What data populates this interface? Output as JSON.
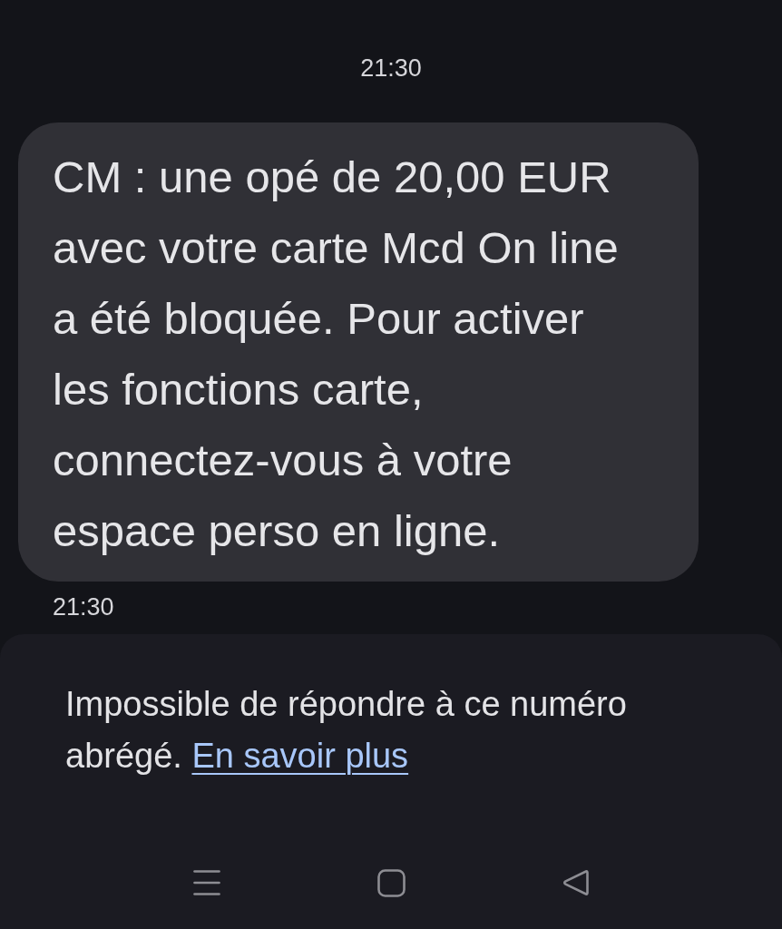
{
  "conversation": {
    "date_time": "21:30",
    "messages": [
      {
        "text": "CM : une opé de 20,00 EUR avec votre carte Mcd On line a été bloquée. Pour activer les fonctions carte, connectez-vous à votre espace perso en ligne.",
        "time": "21:30"
      }
    ]
  },
  "reply_notice": {
    "text": "Impossible de répondre à ce numéro abrégé.",
    "link": "En savoir plus"
  },
  "nav_bar": {
    "buttons": [
      {
        "kind": "menu"
      },
      {
        "kind": "home"
      },
      {
        "kind": "back"
      }
    ]
  }
}
